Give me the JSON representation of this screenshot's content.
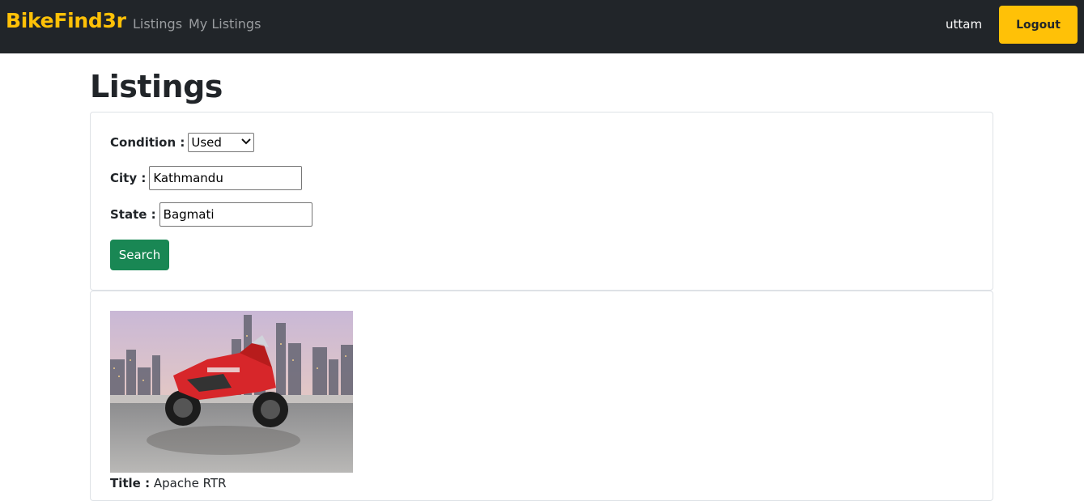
{
  "navbar": {
    "brand": "BikeFind3r",
    "links": [
      "Listings",
      "My Listings"
    ],
    "username": "uttam",
    "logout_label": "Logout"
  },
  "page": {
    "title": "Listings"
  },
  "filters": {
    "condition_label": "Condition :",
    "condition_value": "Used",
    "city_label": "City :",
    "city_value": "Kathmandu",
    "state_label": "State :",
    "state_value": "Bagmati",
    "search_label": "Search"
  },
  "listing": {
    "title_label": "Title :",
    "title_value": "Apache RTR"
  },
  "colors": {
    "navbar_bg": "#212529",
    "brand": "#ffc107",
    "logout_bg": "#ffc107",
    "search_bg": "#198754"
  }
}
